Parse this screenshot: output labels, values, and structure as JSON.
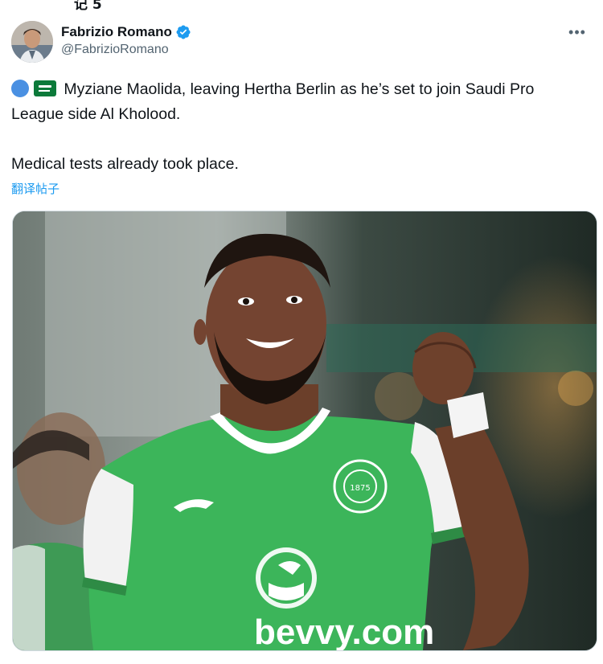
{
  "top_cut_text": "记 5",
  "author": {
    "display_name": "Fabrizio Romano",
    "handle": "@FabrizioRomano",
    "verified": true
  },
  "more_label": "•••",
  "tweet": {
    "line1": "Myziane Maolida, leaving Hertha Berlin as he’s set to join Saudi Pro League side Al Kholood.",
    "line2": "Medical tests already took place.",
    "emojis": [
      "blue-circle-emoji",
      "saudi-flag-emoji"
    ]
  },
  "translate_label": "翻译帖子",
  "media": {
    "jersey_sponsor": "bevvy.com",
    "crest_text": "HIBERNIAN · EDINBURGH",
    "crest_year": "1875"
  },
  "colors": {
    "verified_blue": "#1d9bf0",
    "link_blue": "#1d9bf0",
    "jersey_green": "#3cb55a"
  }
}
